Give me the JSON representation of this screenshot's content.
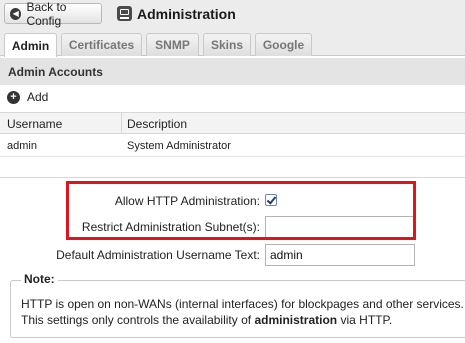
{
  "header": {
    "back_label": "Back to Config",
    "title": "Administration",
    "title_icon": "admin-panel-icon",
    "back_icon": "left-arrow-circle-icon"
  },
  "tabs": [
    {
      "label": "Admin",
      "active": true
    },
    {
      "label": "Certificates",
      "active": false
    },
    {
      "label": "SNMP",
      "active": false
    },
    {
      "label": "Skins",
      "active": false
    },
    {
      "label": "Google",
      "active": false
    }
  ],
  "admin_accounts": {
    "section_title": "Admin Accounts",
    "add_label": "Add",
    "add_icon": "plus-circle-icon",
    "columns": [
      "Username",
      "Description"
    ],
    "rows": [
      {
        "username": "admin",
        "description": "System Administrator"
      }
    ]
  },
  "form": {
    "allow_http_label": "Allow HTTP Administration:",
    "allow_http_checked": true,
    "restrict_subnet_label": "Restrict Administration Subnet(s):",
    "restrict_subnet_value": "",
    "default_username_label": "Default Administration Username Text:",
    "default_username_value": "admin"
  },
  "note": {
    "title": "Note:",
    "line1": "HTTP is open on non-WANs (internal interfaces) for blockpages and other services.",
    "line2_pre": "This settings only controls the availability of ",
    "line2_bold": "administration",
    "line2_post": " via HTTP."
  },
  "colors": {
    "highlight": "#e0141d",
    "tab_bar": "#ececec",
    "section_header": "#e4e4e4"
  }
}
